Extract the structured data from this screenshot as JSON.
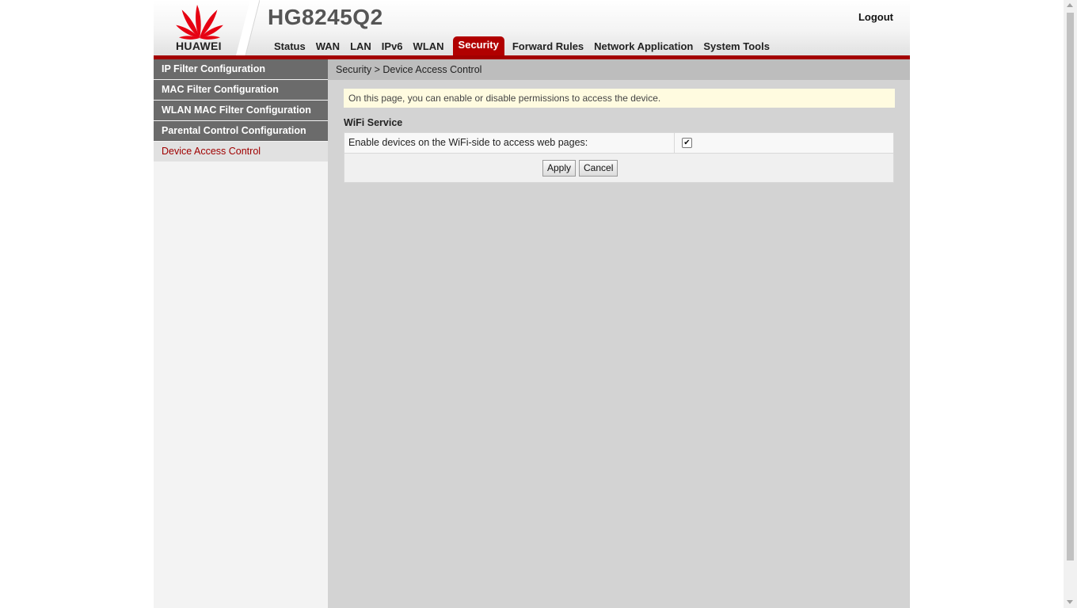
{
  "brand": {
    "logo_text": "HUAWEI",
    "product": "HG8245Q2",
    "logo_color": "#e60012"
  },
  "header": {
    "logout_label": "Logout"
  },
  "nav": {
    "tabs": [
      {
        "label": "Status"
      },
      {
        "label": "WAN"
      },
      {
        "label": "LAN"
      },
      {
        "label": "IPv6"
      },
      {
        "label": "WLAN"
      },
      {
        "label": "Security",
        "active": true
      },
      {
        "label": "Forward Rules"
      },
      {
        "label": "Network Application"
      },
      {
        "label": "System Tools"
      }
    ]
  },
  "sidebar": {
    "items": [
      {
        "label": "IP Filter Configuration"
      },
      {
        "label": "MAC Filter Configuration"
      },
      {
        "label": "WLAN MAC Filter Configuration"
      },
      {
        "label": "Parental Control Configuration"
      },
      {
        "label": "Device Access Control",
        "active": true
      }
    ]
  },
  "main": {
    "breadcrumb": "Security > Device Access Control",
    "notice": "On this page, you can enable or disable permissions to access the device.",
    "section_title": "WiFi Service",
    "field_label": "Enable devices on the WiFi-side to access web pages:",
    "field_checked": true,
    "check_mark": "✔",
    "apply_label": "Apply",
    "cancel_label": "Cancel"
  },
  "colors": {
    "accent": "#a30000",
    "sidebar_bg": "#6b6b6b",
    "content_bg": "#d3d3d3",
    "notice_bg": "#fffbe0"
  }
}
